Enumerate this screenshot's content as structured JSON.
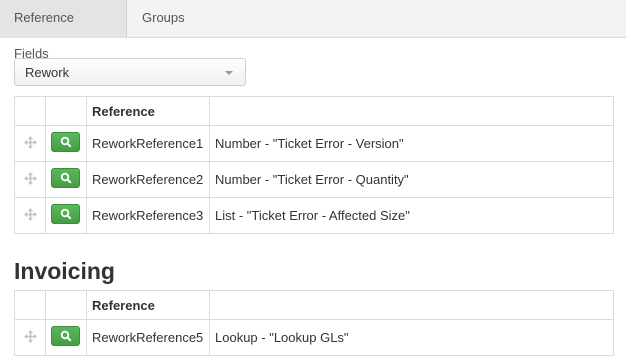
{
  "tabs": [
    {
      "label": "Reference Fields",
      "active": true
    },
    {
      "label": "Groups",
      "active": false
    }
  ],
  "selector": {
    "value": "Rework"
  },
  "table1": {
    "header": "Reference",
    "rows": [
      {
        "reference": "ReworkReference1",
        "description": "Number - \"Ticket Error - Version\""
      },
      {
        "reference": "ReworkReference2",
        "description": "Number - \"Ticket Error - Quantity\""
      },
      {
        "reference": "ReworkReference3",
        "description": "List - \"Ticket Error - Affected Size\""
      }
    ]
  },
  "invoicing": {
    "title": "Invoicing",
    "header": "Reference",
    "rows": [
      {
        "reference": "ReworkReference5",
        "description": "Lookup - \"Lookup GLs\""
      }
    ]
  },
  "colors": {
    "accent_green": "#5cb85c",
    "tab_bg": "#f3f3f3",
    "border": "#dcdcdc"
  },
  "icons": {
    "row_handle": "move-icon",
    "row_button": "search-icon",
    "dropdown": "caret-down-icon"
  }
}
